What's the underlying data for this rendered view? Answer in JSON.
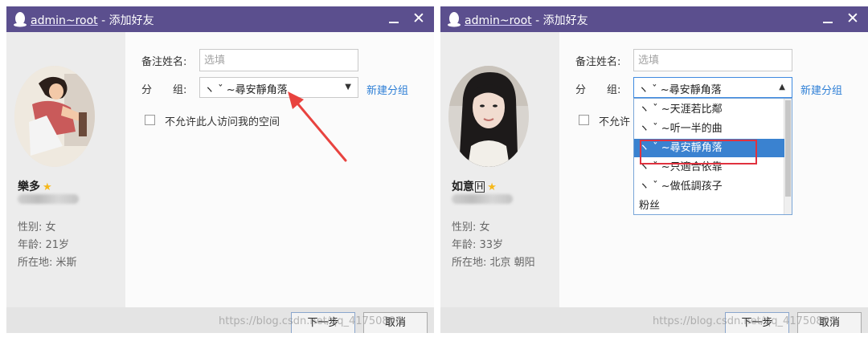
{
  "accent_color": "#5b4f8e",
  "windows": [
    {
      "title_user": "admin~root",
      "title_suffix": " - 添加好友",
      "profile": {
        "nick": "樂多",
        "badge": "",
        "info": [
          "性别: 女",
          "年龄: 21岁",
          "所在地:  米斯"
        ]
      },
      "form": {
        "remark_label": "备注姓名:",
        "remark_placeholder": "选填",
        "group_label": "分　　组:",
        "group_value": "ヽ ˇ ~尋安靜角落",
        "new_group": "新建分组",
        "checkbox_label": "不允许此人访问我的空间",
        "dropdown_open": false,
        "dropdown_items": []
      },
      "buttons": {
        "next": "下一步",
        "cancel": "取消"
      },
      "watermark": "https://blog.csdn.net/qq_41750806"
    },
    {
      "title_user": "admin~root",
      "title_suffix": " - 添加好友",
      "profile": {
        "nick": "如意",
        "badge": "H",
        "info": [
          "性别: 女",
          "年龄: 33岁",
          "所在地:  北京  朝阳"
        ]
      },
      "form": {
        "remark_label": "备注姓名:",
        "remark_placeholder": "选填",
        "group_label": "分　　组:",
        "group_value": "ヽ ˇ ~尋安靜角落",
        "new_group": "新建分组",
        "checkbox_label": "不允许",
        "dropdown_open": true,
        "dropdown_items": [
          "ヽ ˇ ~天涯若比鄰",
          "ヽ ˇ ~听一半的曲",
          "ヽ ˇ ~尋安靜角落",
          "ヽ ˇ ~只適合依靠",
          "ヽ ˇ ~做低調孩子",
          "粉丝"
        ],
        "dropdown_selected": 2
      },
      "buttons": {
        "next": "下一步",
        "cancel": "取消"
      },
      "watermark": "https://blog.csdn.net/qq_41750806"
    }
  ]
}
